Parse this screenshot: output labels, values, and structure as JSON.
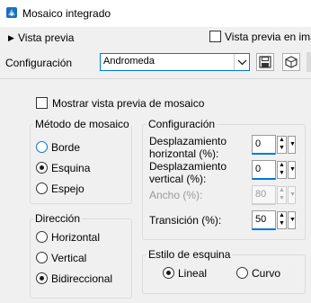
{
  "window": {
    "title": "Mosaico integrado",
    "icon": "paint-shop-pro-icon"
  },
  "preview": {
    "toggle_label": "Vista previa",
    "toggle_icon": "caret-right-icon",
    "window_checkbox_label": "Vista previa en ima",
    "window_checkbox_checked": false
  },
  "config": {
    "label": "Configuración",
    "selected_preset": "Andromeda",
    "save_icon": "save-icon",
    "reset_icon": "reset-icon"
  },
  "options": {
    "mosaic_preview_label": "Mostrar vista previa de mosaico",
    "mosaic_preview_checked": false
  },
  "method": {
    "title": "Método de mosaico",
    "options": [
      {
        "label": "Borde",
        "checked": false
      },
      {
        "label": "Esquina",
        "checked": true
      },
      {
        "label": "Espejo",
        "checked": false
      }
    ]
  },
  "settings": {
    "title": "Configuración",
    "horizontal_offset": {
      "label_line1": "Desplazamiento",
      "label_line2": "horizontal (%):",
      "value": "0"
    },
    "vertical_offset": {
      "label_line1": "Desplazamiento",
      "label_line2": "vertical (%):",
      "value": "0"
    },
    "width": {
      "label": "Ancho (%):",
      "value": "80",
      "enabled": false
    },
    "transition": {
      "label": "Transición (%):",
      "value": "50"
    }
  },
  "direction": {
    "title": "Dirección",
    "options": [
      {
        "label": "Horizontal",
        "checked": false
      },
      {
        "label": "Vertical",
        "checked": false
      },
      {
        "label": "Bidireccional",
        "checked": true
      }
    ]
  },
  "corner_style": {
    "title": "Estilo de esquina",
    "options": [
      {
        "label": "Lineal",
        "checked": true
      },
      {
        "label": "Curvo",
        "checked": false
      }
    ]
  },
  "colors": {
    "accent": "#0078d7",
    "window_bg": "#f0f0f0",
    "titlebar_bg": "#ffffff"
  }
}
